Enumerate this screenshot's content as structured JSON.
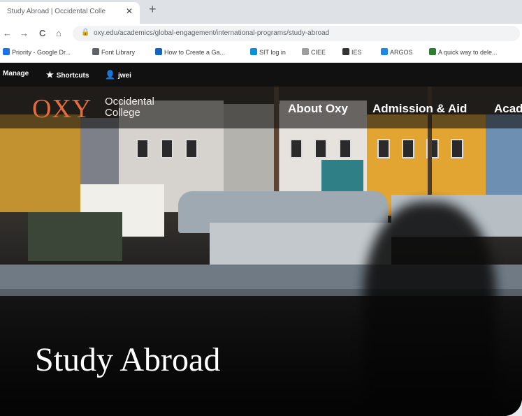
{
  "browser": {
    "tab_title": "Study Abroad | Occidental Colle",
    "tab_close": "✕",
    "new_tab": "+",
    "back": "←",
    "forward": "→",
    "reload": "C",
    "home": "⌂",
    "lock": "🔒",
    "url": "oxy.edu/academics/global-engagement/international-programs/study-abroad"
  },
  "bookmarks": [
    {
      "label": "Priority - Google Dr...",
      "color": "#1a73e8"
    },
    {
      "label": "Font Library",
      "color": "#5f6368"
    },
    {
      "label": "How to Create a Ga...",
      "color": "#1565c0"
    },
    {
      "label": "SIT log in",
      "color": "#0b8fd6"
    },
    {
      "label": "CIEE",
      "color": "#9e9e9e"
    },
    {
      "label": "IES",
      "color": "#333333"
    },
    {
      "label": "ARGOS",
      "color": "#1e88e5"
    },
    {
      "label": "A quick way to dele...",
      "color": "#2e7d32"
    }
  ],
  "admin_bar": {
    "manage": "Manage",
    "shortcuts": "Shortcuts",
    "user": "jwei"
  },
  "site": {
    "logo_main": "OXY",
    "logo_sub_1": "Occidental",
    "logo_sub_2": "College",
    "nav": [
      "About Oxy",
      "Admission & Aid",
      "Acad"
    ],
    "hero_title": "Study Abroad",
    "accent_color": "#e46b3b"
  }
}
